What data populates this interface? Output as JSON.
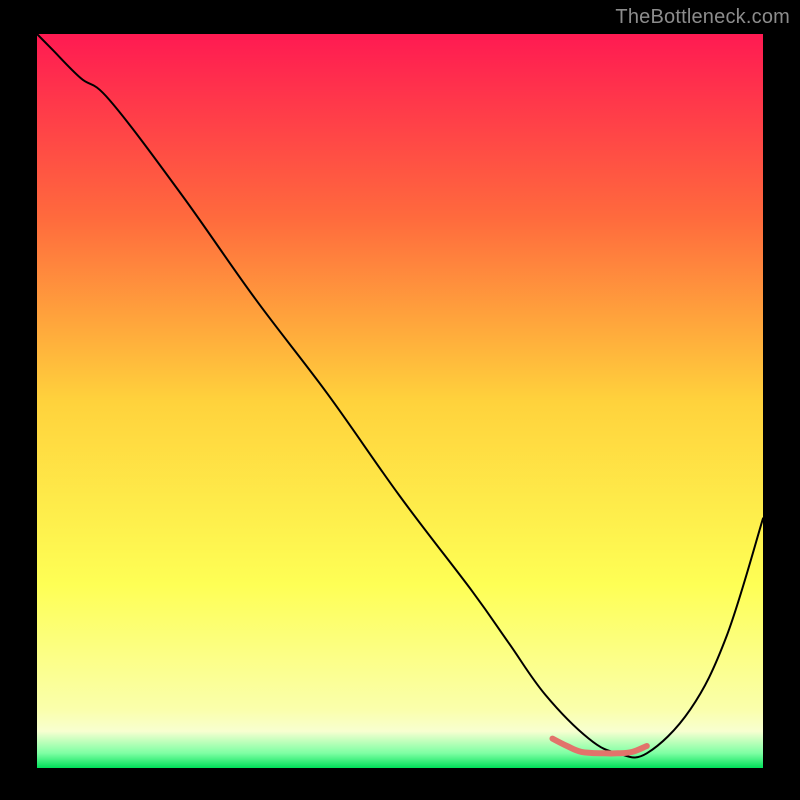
{
  "attribution": "TheBottleneck.com",
  "chart_data": {
    "type": "line",
    "title": "",
    "xlabel": "",
    "ylabel": "",
    "xlim": [
      0,
      100
    ],
    "ylim": [
      0,
      100
    ],
    "grid": false,
    "legend": false,
    "background_gradient": {
      "stops": [
        {
          "offset": 0.0,
          "color": "#ff1a52"
        },
        {
          "offset": 0.25,
          "color": "#ff6a3d"
        },
        {
          "offset": 0.5,
          "color": "#ffd23c"
        },
        {
          "offset": 0.75,
          "color": "#feff55"
        },
        {
          "offset": 0.92,
          "color": "#faffab"
        },
        {
          "offset": 0.95,
          "color": "#f8ffd0"
        },
        {
          "offset": 0.98,
          "color": "#7dffa3"
        },
        {
          "offset": 1.0,
          "color": "#00e05a"
        }
      ]
    },
    "series": [
      {
        "name": "bottleneck-curve",
        "color": "#000000",
        "width": 2,
        "x": [
          0,
          2,
          6,
          10,
          20,
          30,
          40,
          50,
          60,
          65,
          70,
          76,
          80,
          84,
          90,
          95,
          100
        ],
        "y": [
          100,
          98,
          94,
          91,
          78,
          64,
          51,
          37,
          24,
          17,
          10,
          4,
          2,
          2,
          8,
          18,
          34
        ]
      },
      {
        "name": "optimal-range",
        "color": "#e2736b",
        "width": 6,
        "x": [
          71,
          73,
          75,
          78,
          80,
          82,
          84
        ],
        "y": [
          4.0,
          3.0,
          2.2,
          2.0,
          2.0,
          2.2,
          3.0
        ]
      }
    ]
  }
}
